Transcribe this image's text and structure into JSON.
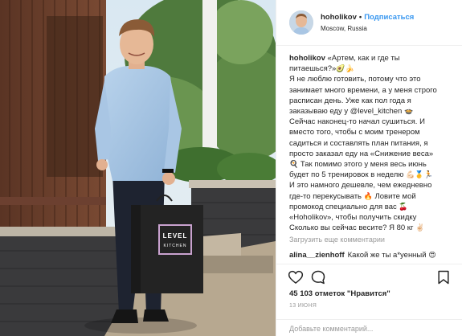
{
  "post": {
    "author": "hoholikov",
    "follow_label": "Подписаться",
    "location": "Moscow, Russia",
    "bag_brand_top": "LEVEL",
    "bag_brand_bottom": "KITCHEN"
  },
  "caption": {
    "lines": [
      {
        "text": "«Артем, как и где ты",
        "emoji": ""
      },
      {
        "text": "питаешься?»",
        "emoji": "🥑🍌"
      },
      {
        "text": "Я не люблю готовить, потому что это",
        "emoji": ""
      },
      {
        "text": "занимает много времени, а у меня строго",
        "emoji": ""
      },
      {
        "text": "расписан день. Уже как пол года я",
        "emoji": ""
      },
      {
        "text": "заказываю еду у @level_kitchen",
        "emoji": "🍲"
      },
      {
        "text": "Сейчас наконец-то начал сушиться. И",
        "emoji": ""
      },
      {
        "text": "вместо того, чтобы с моим тренером",
        "emoji": ""
      },
      {
        "text": "садиться и составлять план питания, я",
        "emoji": ""
      },
      {
        "text": "просто заказал еду на «Снижение веса»",
        "emoji": ""
      },
      {
        "text": " Так помимо этого у меня весь июнь",
        "emoji": "🍳"
      },
      {
        "text": "будет по 5 тренировок в неделю",
        "emoji": "💪🏻🥇🏃"
      },
      {
        "text": "И это намного дешевле, чем ежедневно",
        "emoji": ""
      },
      {
        "text": "где-то перекусывать",
        "emoji": "🔥"
      },
      {
        "text": " Ловите мой",
        "emoji": ""
      },
      {
        "text": "промокод специально для вас",
        "emoji": "🍒"
      },
      {
        "text": "«Hoholikov», чтобы получить скидку",
        "emoji": ""
      },
      {
        "text": "Сколько вы сейчас весите? Я 80 кг",
        "emoji": "✌🏻"
      }
    ]
  },
  "load_more_label": "Загрузить еще комментарии",
  "comment": {
    "user": "alina__zienhoff",
    "text": "Какой же ты а*уенный",
    "emoji": "😍"
  },
  "likes_label": "45 103 отметок \"Нравится\"",
  "date_label": "13 ИЮНЯ",
  "add_comment_placeholder": "Добавьте комментарий...",
  "icons": {
    "like": "heart-icon",
    "comment": "comment-icon",
    "save": "bookmark-icon"
  },
  "colors": {
    "follow": "#3897f0",
    "muted": "#999999",
    "text": "#262626"
  }
}
